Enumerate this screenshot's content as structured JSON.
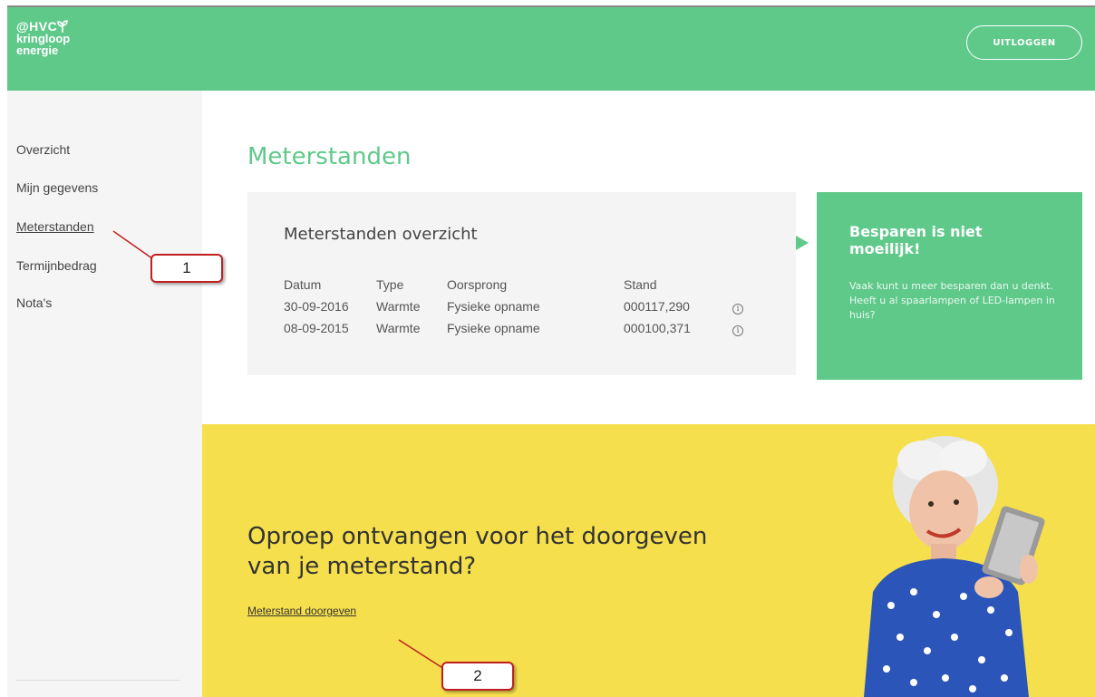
{
  "header": {
    "logo_line1": "HVC",
    "logo_line2": "kringloop",
    "logo_line3": "energie",
    "logout_label": "UITLOGGEN",
    "brand_color": "#5fc98a"
  },
  "sidebar": {
    "items": [
      {
        "label": "Overzicht"
      },
      {
        "label": "Mijn gegevens"
      },
      {
        "label": "Meterstanden"
      },
      {
        "label": "Termijnbedrag"
      },
      {
        "label": "Nota's"
      }
    ],
    "active_item": "Meterstanden"
  },
  "main": {
    "page_title": "Meterstanden",
    "card": {
      "title": "Meterstanden overzicht",
      "columns": [
        "Datum",
        "Type",
        "Oorsprong",
        "Stand"
      ],
      "rows": [
        {
          "datum": "30-09-2016",
          "type": "Warmte",
          "oorsprong": "Fysieke opname",
          "stand": "000117,290",
          "info_icon": "info-icon"
        },
        {
          "datum": "08-09-2015",
          "type": "Warmte",
          "oorsprong": "Fysieke opname",
          "stand": "000100,371",
          "info_icon": "info-icon"
        }
      ]
    },
    "tip": {
      "title": "Besparen is niet moeilijk!",
      "text": "Vaak kunt u meer besparen dan u denkt. Heeft u al spaarlampen of LED-lampen in huis?"
    },
    "cta": {
      "title": "Oproep ontvangen voor het doorgeven van je meterstand?",
      "link": "Meterstand doorgeven",
      "panel_color": "#f6df4d"
    }
  },
  "annotations": {
    "callout_1": "1",
    "callout_2": "2",
    "callout_color": "#c02020"
  }
}
